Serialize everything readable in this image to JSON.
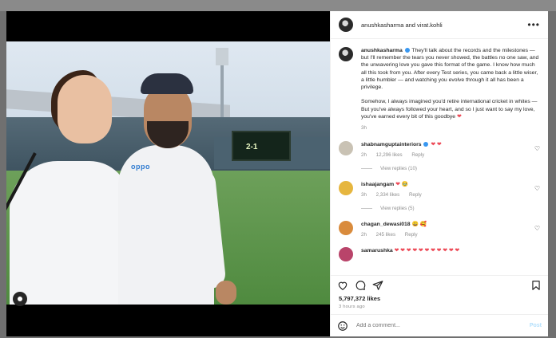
{
  "header": {
    "title": "anushkasharma and virat.kohli",
    "more_icon": "more-horizontal-icon"
  },
  "photo": {
    "jersey_brand": "oppo",
    "scoreboard": "2-1"
  },
  "caption": {
    "username": "anushkasharma",
    "text": "They'll talk about the records and the milestones — but I'll remember the tears you never showed, the battles no one saw, and the unwavering love you gave this format of the game. I know how much all this took from you. After every Test series, you came back a little wiser, a little humbler — and watching you evolve through it all has been a privilege.",
    "text2": "Somehow, I always imagined you'd retire international cricket in whites — But you've always followed your heart, and so I just want to say my love, you've earned every bit of this goodbye",
    "time": "3h"
  },
  "comments": [
    {
      "username": "shabnamguptainteriors",
      "emojis": "❤ ❤",
      "time": "2h",
      "likes": "12,296 likes",
      "reply": "Reply",
      "view_replies": "View replies (10)",
      "avatar_color": "#c9c2b4"
    },
    {
      "username": "ishaajangam",
      "emojis": "❤ 🥹",
      "time": "3h",
      "likes": "2,334 likes",
      "reply": "Reply",
      "view_replies": "View replies (5)",
      "avatar_color": "#e6b63f"
    },
    {
      "username": "chagan_dewasi018",
      "emojis": "😀 🥰",
      "time": "2h",
      "likes": "245 likes",
      "reply": "Reply",
      "avatar_color": "#d98b3c"
    },
    {
      "username": "samarushka",
      "emojis": "❤ ❤ ❤ ❤ ❤ ❤ ❤ ❤ ❤ ❤ ❤",
      "avatar_color": "#b9446a"
    }
  ],
  "actions": {
    "like": "heart-outline-icon",
    "comment": "comment-icon",
    "share": "share-icon",
    "save": "bookmark-icon"
  },
  "likes_count": "5,797,372 likes",
  "posted_ago": "3 hours ago",
  "add_comment": {
    "placeholder": "Add a comment...",
    "post_label": "Post",
    "emoji_icon": "emoji-icon"
  }
}
